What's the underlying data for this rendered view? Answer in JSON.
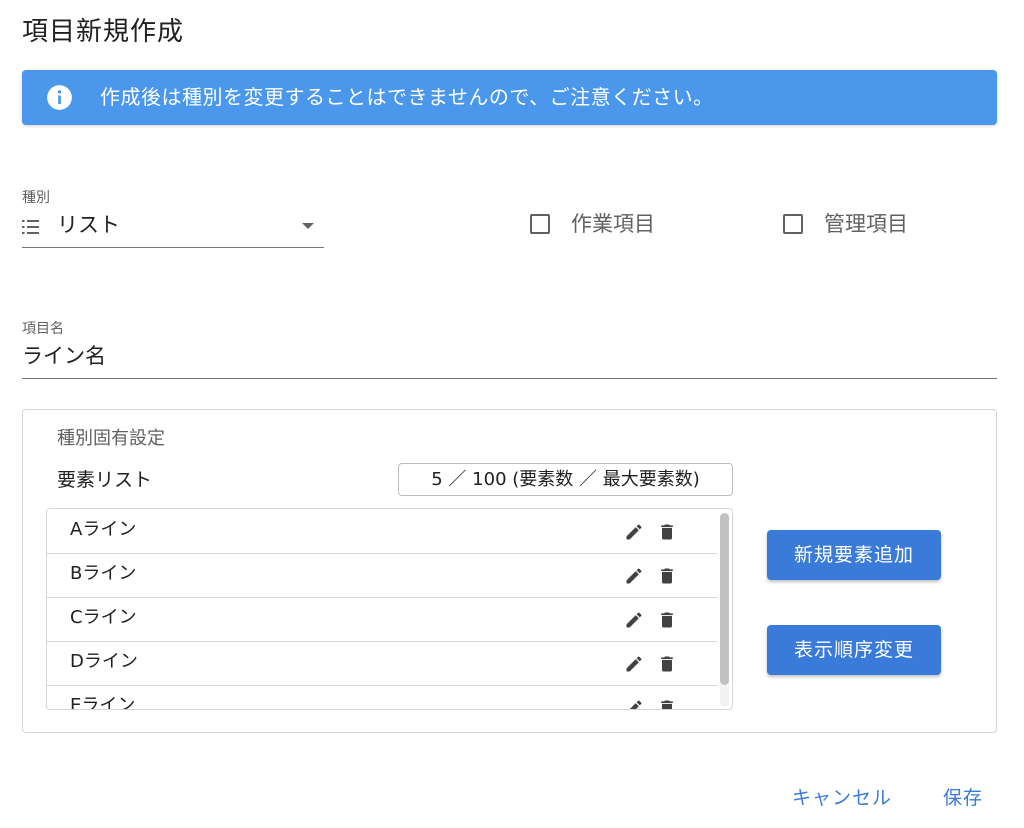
{
  "dialog": {
    "title": "項目新規作成"
  },
  "alert": {
    "icon": "info-icon",
    "message": "作成後は種別を変更することはできませんので、ご注意ください。",
    "color": "#4a97ec"
  },
  "type_field": {
    "label": "種別",
    "icon": "list-icon",
    "value": "リスト"
  },
  "checkboxes": {
    "work_item": {
      "label": "作業項目",
      "checked": false
    },
    "management_item": {
      "label": "管理項目",
      "checked": false
    }
  },
  "name_field": {
    "label": "項目名",
    "value": "ライン名"
  },
  "settings": {
    "title": "種別固有設定",
    "elements_label": "要素リスト",
    "count_text": "5 ／ 100 (要素数 ／ 最大要素数)",
    "elements": [
      {
        "label": "Aライン"
      },
      {
        "label": "Bライン"
      },
      {
        "label": "Cライン"
      },
      {
        "label": "Dライン"
      },
      {
        "label": "Eライン"
      }
    ],
    "add_button": "新規要素追加",
    "reorder_button": "表示順序変更"
  },
  "footer": {
    "cancel_label": "キャンセル",
    "save_label": "保存"
  },
  "colors": {
    "primary": "#3a7ad8",
    "alert": "#4a97ec"
  }
}
